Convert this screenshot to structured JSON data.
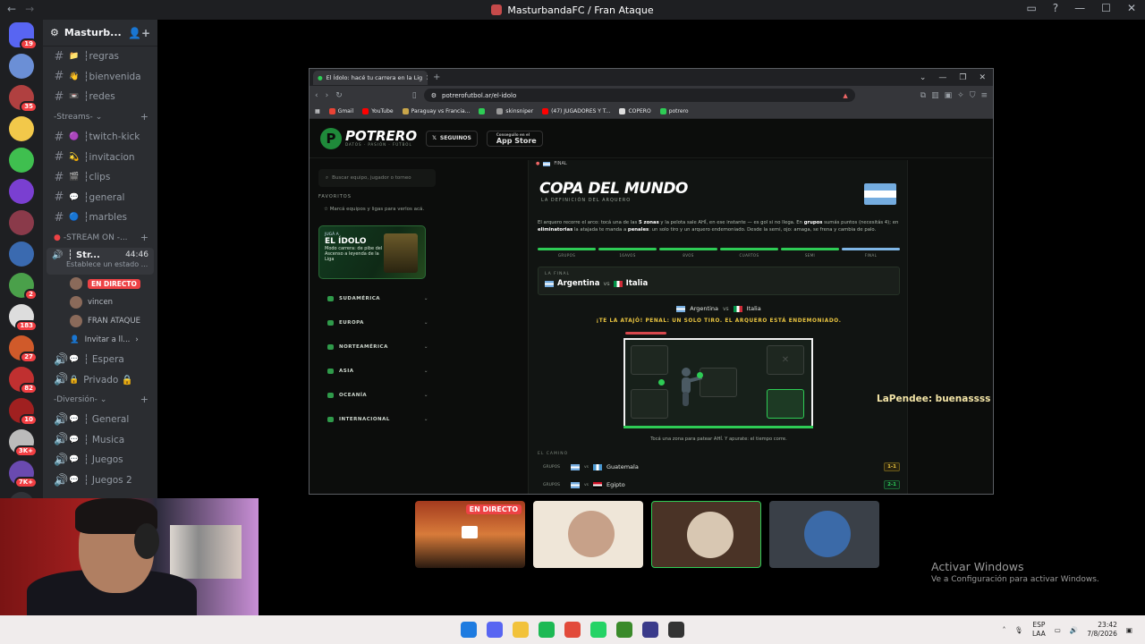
{
  "window": {
    "title": "MasturbandaFC / Fran Ataque"
  },
  "servers": [
    {
      "color": "#5865f2",
      "badge": "19"
    },
    {
      "color": "#6b8fd6",
      "badge": ""
    },
    {
      "color": "#b04040",
      "badge": "35"
    },
    {
      "color": "#f2c84a",
      "badge": ""
    },
    {
      "color": "#3fbf4f",
      "badge": ""
    },
    {
      "color": "#7a3fd1",
      "badge": ""
    },
    {
      "color": "#8a3a4a",
      "badge": ""
    },
    {
      "color": "#3a6ab0",
      "badge": ""
    },
    {
      "color": "#4aa04a",
      "badge": "2"
    },
    {
      "color": "#ddd",
      "badge": "183"
    },
    {
      "color": "#d05a2a",
      "badge": "27"
    },
    {
      "color": "#c03030",
      "badge": "82"
    },
    {
      "color": "#a02020",
      "badge": "10"
    },
    {
      "color": "#bbb",
      "badge": "3K+"
    },
    {
      "color": "#6a4ab0",
      "badge": "7K+"
    }
  ],
  "sidebar": {
    "server_name": "Masturb...",
    "channels_top": [
      {
        "emoji": "📁",
        "name": "┆regras"
      },
      {
        "emoji": "👋",
        "name": "┆bienvenida"
      },
      {
        "emoji": "📼",
        "name": "┆redes"
      }
    ],
    "cat_streams": "-Streams-",
    "channels_streams": [
      {
        "emoji": "🟣",
        "name": "┆twitch-kick"
      },
      {
        "emoji": "💫",
        "name": "┆invitacion"
      },
      {
        "emoji": "🎬",
        "name": "┆clips"
      },
      {
        "emoji": "💬",
        "name": "┆general"
      },
      {
        "emoji": "🔵",
        "name": "┆marbles"
      }
    ],
    "cat_live": "-STREAM ON -...",
    "active_voice": {
      "name": "┆ Str...",
      "time": "44:46",
      "status": "Establece un estado ..."
    },
    "voice_users": [
      {
        "name": "",
        "live": "EN DIRECTO"
      },
      {
        "name": "vincen",
        "live": ""
      },
      {
        "name": "FRAN ATAQUE",
        "live": ""
      }
    ],
    "invite": "Invitar a ll...",
    "voice_channels": [
      {
        "emoji": "💬",
        "name": "┆ Espera"
      },
      {
        "emoji": "🔒",
        "name": "Privado 🔒"
      }
    ],
    "cat_div": "-Diversión-",
    "voice_div": [
      {
        "emoji": "💬",
        "name": "┆ General"
      },
      {
        "emoji": "💬",
        "name": "┆ Musica"
      },
      {
        "emoji": "💬",
        "name": "┆ Juegos"
      },
      {
        "emoji": "💬",
        "name": "┆ Juegos 2"
      }
    ]
  },
  "browser": {
    "tab_title": "El Ídolo: hacé tu carrera en la Lig",
    "url": "potrerofutbol.ar/el-idolo",
    "bookmarks": [
      {
        "label": "Gmail",
        "color": "#ea4335"
      },
      {
        "label": "YouTube",
        "color": "#ff0000"
      },
      {
        "label": "Paraguay vs Francia...",
        "color": "#c9a64a"
      },
      {
        "label": "",
        "color": "#2ecc55"
      },
      {
        "label": "skinsniper",
        "color": "#999"
      },
      {
        "label": "(47) JUGADORES Y T...",
        "color": "#ff0000"
      },
      {
        "label": "COPERO",
        "color": "#ddd"
      },
      {
        "label": "potrero",
        "color": "#2ecc55"
      }
    ]
  },
  "site": {
    "logo": "POTRERO",
    "logo_tag": "DATOS · PASIÓN · FÚTBOL",
    "follow": "SEGUINOS",
    "appstore_small": "Conseguilo en el",
    "appstore": "App Store",
    "search_placeholder": "Buscar equipo, jugador o torneo",
    "favs_title": "FAVORITOS",
    "favs_text": "Marcá equipos y ligas para verlos acá.",
    "promo": {
      "small": "JUGÁ A",
      "title": "EL ÍDOLO",
      "desc": "Modo carrera: de pibe del Ascenso a leyenda de la Liga"
    },
    "regions": [
      "SUDAMÉRICA",
      "EUROPA",
      "NORTEAMÉRICA",
      "ASIA",
      "OCEANÍA",
      "INTERNACIONAL"
    ],
    "main_top": "FINAL",
    "title": "COPA DEL MUNDO",
    "subtitle": "LA DEFINICIÓN DEL ARQUERO",
    "desc_pre": "El arquero recorre el arco: tocá una de las ",
    "desc_b1": "5 zonas",
    "desc_mid1": " y la pelota sale AHÍ, en ese instante — es gol si no llega. En ",
    "desc_b2": "grupos",
    "desc_mid2": " sumás puntos (necesitás 4); en ",
    "desc_b3": "eliminatorias",
    "desc_mid3": " la atajada te manda a ",
    "desc_b4": "penales",
    "desc_post": ": un solo tiro y un arquero endemoniado. Desde la semi, ojo: amaga, se frena y cambia de palo.",
    "stages": [
      "GRUPOS",
      "16AVOS",
      "8VOS",
      "CUARTOS",
      "SEMI",
      "FINAL"
    ],
    "final_label": "LA FINAL",
    "team_a": "Argentina",
    "team_b": "Italia",
    "vs": "vs",
    "alert": "¡TE LA ATAJÓ! PENAL: UN SOLO TIRO. EL ARQUERO ESTÁ ENDEMONIADO.",
    "hint": "Tocá una zona para patear AHÍ. Y apurate: el tiempo corre.",
    "path_label": "EL CAMINO",
    "matches": [
      {
        "stage": "GRUPOS",
        "team": "Guatemala",
        "flag": "flag-gt",
        "score": "1-1",
        "kind": "y"
      },
      {
        "stage": "GRUPOS",
        "team": "Egipto",
        "flag": "flag-eg",
        "score": "2-1",
        "kind": "g"
      }
    ]
  },
  "chat_overlay": "LaPendee: buenassss",
  "stream_tiles": [
    {
      "bg": "linear-gradient(#a33a1e,#d87b3a 50%,#2a1a10)",
      "live": "EN DIRECTO",
      "avatar": ""
    },
    {
      "bg": "#efe6d8",
      "live": "",
      "avatar": "#c7a189"
    },
    {
      "bg": "#4a3326",
      "live": "",
      "avatar": "#d8c7b2"
    },
    {
      "bg": "#3a4048",
      "live": "",
      "avatar": "#3b6aa8"
    }
  ],
  "activate": {
    "title": "Activar Windows",
    "sub": "Ve a Configuración para activar Windows."
  },
  "taskbar": {
    "apps": [
      "#1e7be0",
      "#5865f2",
      "#f2c23a",
      "#1db954",
      "#e24a3a",
      "#25d366",
      "#3a8a2a",
      "#3a3a8a",
      "#333"
    ],
    "lang1": "ESP",
    "lang2": "LAA",
    "time": "23:42",
    "date": "7/8/2026"
  }
}
